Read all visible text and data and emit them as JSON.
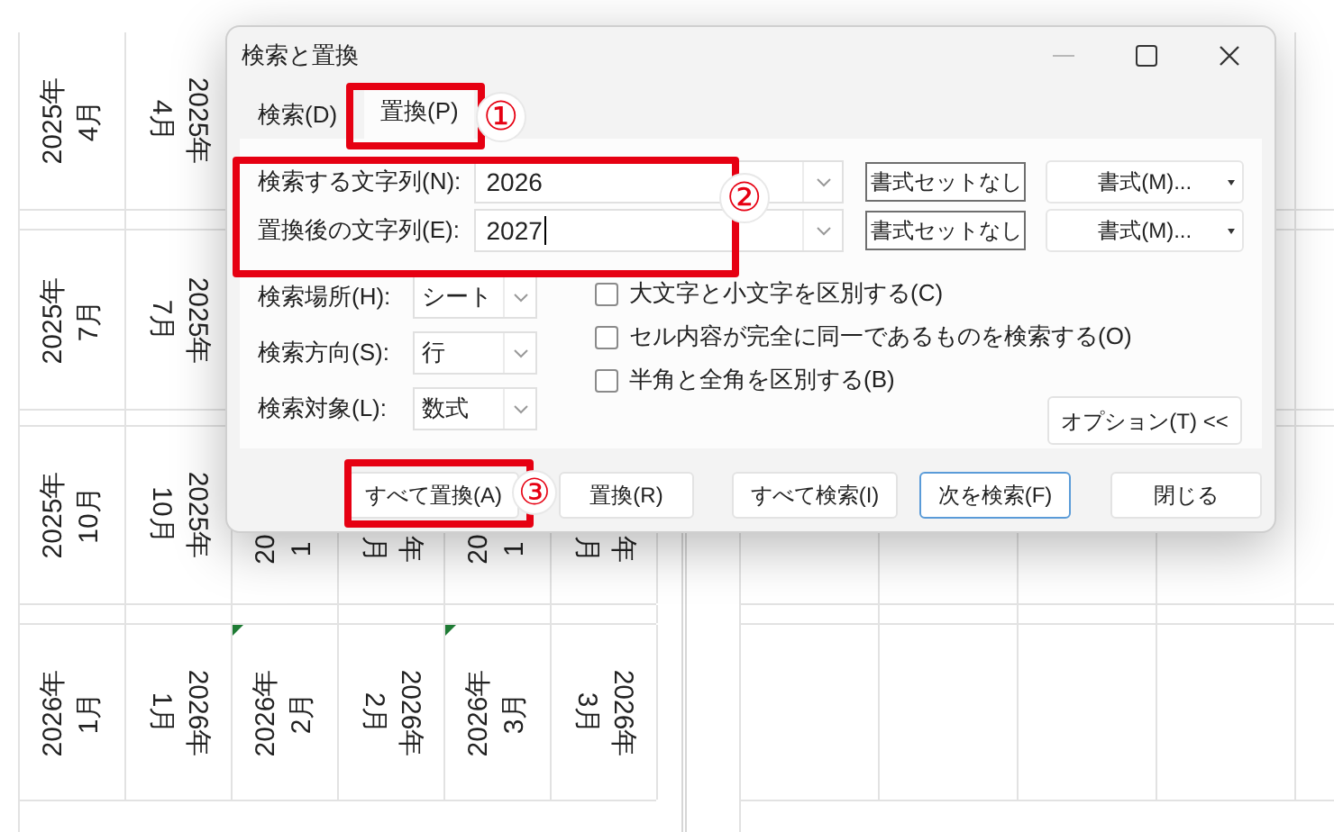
{
  "sheet": {
    "rows": [
      {
        "cells": [
          {
            "kind": "up",
            "lines": [
              "2025年",
              "4月"
            ],
            "flagged": false
          },
          {
            "kind": "down",
            "lines": [
              "2025年",
              "4月"
            ],
            "flagged": false
          }
        ]
      },
      {
        "cells": [
          {
            "kind": "up",
            "lines": [
              "2025年",
              "7月"
            ],
            "flagged": false
          },
          {
            "kind": "down",
            "lines": [
              "2025年",
              "7月"
            ],
            "flagged": false
          }
        ]
      },
      {
        "cells": [
          {
            "kind": "up",
            "lines": [
              "2025年",
              "10月"
            ],
            "flagged": false
          },
          {
            "kind": "down",
            "lines": [
              "2025年",
              "10月"
            ],
            "flagged": false
          },
          {
            "kind": "up-partial",
            "lines": [
              "20",
              "1"
            ]
          },
          {
            "kind": "down-partial",
            "lines": [
              "年",
              "月"
            ]
          },
          {
            "kind": "up-partial",
            "lines": [
              "20",
              "1"
            ]
          },
          {
            "kind": "down-partial",
            "lines": [
              "年",
              "月"
            ]
          }
        ]
      },
      {
        "cells": [
          {
            "kind": "up",
            "lines": [
              "2026年",
              "1月"
            ],
            "flagged": false
          },
          {
            "kind": "down",
            "lines": [
              "2026年",
              "1月"
            ],
            "flagged": false
          },
          {
            "kind": "up",
            "lines": [
              "2026年",
              "2月"
            ],
            "flagged": true
          },
          {
            "kind": "down",
            "lines": [
              "2026年",
              "2月"
            ],
            "flagged": false
          },
          {
            "kind": "up",
            "lines": [
              "2026年",
              "3月"
            ],
            "flagged": true
          },
          {
            "kind": "down",
            "lines": [
              "2026年",
              "3月"
            ],
            "flagged": false
          }
        ]
      }
    ]
  },
  "dialog": {
    "title": "検索と置換",
    "tabs": [
      {
        "label": "検索(D)",
        "selected": false
      },
      {
        "label": "置換(P)",
        "selected": true
      }
    ],
    "fields": [
      {
        "label": "検索する文字列(N):",
        "value": "2026",
        "focused": false,
        "clear_format_button": "書式セットなし",
        "format_button": "書式(M)..."
      },
      {
        "label": "置換後の文字列(E):",
        "value": "2027",
        "focused": true,
        "clear_format_button": "書式セットなし",
        "format_button": "書式(M)..."
      }
    ],
    "selects": [
      {
        "label": "検索場所(H):",
        "value": "シート"
      },
      {
        "label": "検索方向(S):",
        "value": "行"
      },
      {
        "label": "検索対象(L):",
        "value": "数式"
      }
    ],
    "checkboxes": [
      {
        "label": "大文字と小文字を区別する(C)",
        "checked": false
      },
      {
        "label": "セル内容が完全に同一であるものを検索する(O)",
        "checked": false
      },
      {
        "label": "半角と全角を区別する(B)",
        "checked": false
      }
    ],
    "options_button": "オプション(T) <<",
    "buttons": [
      {
        "label": "すべて置換(A)",
        "default": false
      },
      {
        "label": "置換(R)",
        "default": false
      },
      {
        "label": "すべて検索(I)",
        "default": false
      },
      {
        "label": "次を検索(F)",
        "default": true
      },
      {
        "label": "閉じる",
        "default": false
      }
    ]
  },
  "callouts": [
    {
      "label": "①"
    },
    {
      "label": "②"
    },
    {
      "label": "③"
    }
  ]
}
